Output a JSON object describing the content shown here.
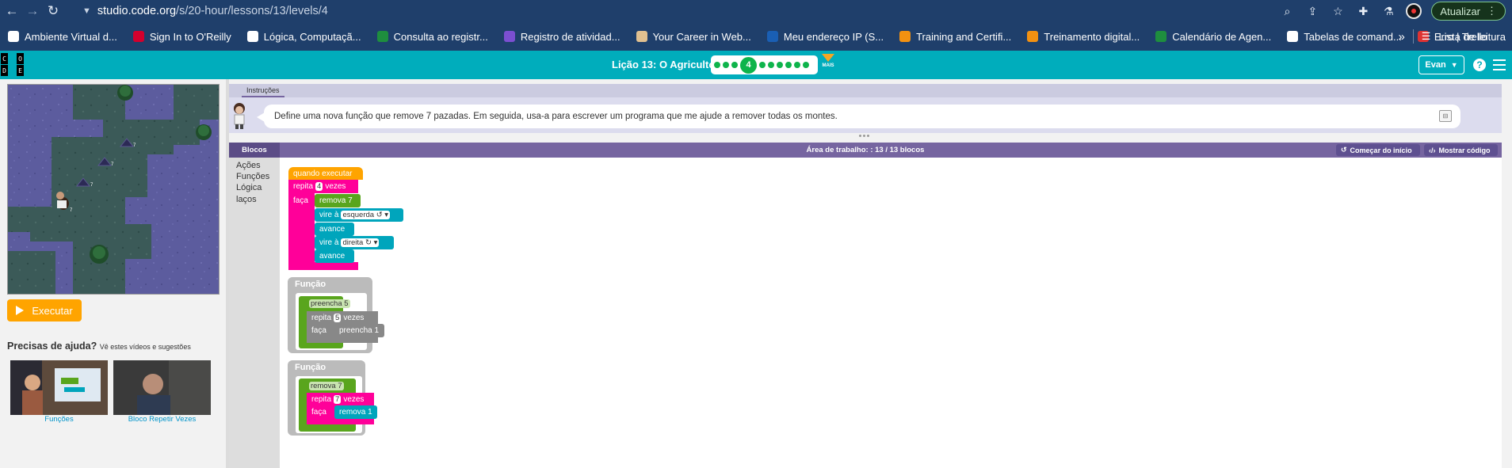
{
  "browser": {
    "url_host": "studio.code.org",
    "url_path": "/s/20-hour/lessons/13/levels/4",
    "update_label": "Atualizar"
  },
  "bookmarks": [
    {
      "label": "Ambiente Virtual d...",
      "color": "#ffffff"
    },
    {
      "label": "Sign In to O'Reilly",
      "color": "#d3002d"
    },
    {
      "label": "Lógica, Computaçã...",
      "color": "#ffffff"
    },
    {
      "label": "Consulta ao registr...",
      "color": "#1e8e3e"
    },
    {
      "label": "Registro de atividad...",
      "color": "#7b4fd1"
    },
    {
      "label": "Your Career in Web...",
      "color": "#e0c090"
    },
    {
      "label": "Meu endereço IP (S...",
      "color": "#1a5fb4"
    },
    {
      "label": "Training and Certifi...",
      "color": "#f29111"
    },
    {
      "label": "Treinamento digital...",
      "color": "#f29111"
    },
    {
      "label": "Calendário de Agen...",
      "color": "#1e8e3e"
    },
    {
      "label": "Tabelas de comand...",
      "color": "#ffffff"
    },
    {
      "label": "Erro | Trello",
      "color": "#d33"
    }
  ],
  "bookmarks_more": "»",
  "reading_list": "Lista de leitura",
  "header": {
    "logo_letters": [
      "C",
      "O",
      "D",
      "E"
    ],
    "lesson_title": "Lição 13: O Agricultor 2",
    "current_level": "4",
    "more_label": "MAIS",
    "user_name": "Evan",
    "help_glyph": "?"
  },
  "left": {
    "run_label": "Executar",
    "help_title": "Precisas de ajuda?",
    "help_sub": "Vê estes vídeos e sugestões",
    "videos": [
      {
        "label": "Funções"
      },
      {
        "label": "Bloco Repetir Vezes"
      }
    ]
  },
  "instructions": {
    "tab_label": "Instruções",
    "text": "Define uma nova função que remove 7 pazadas. Em seguida, usa-a para escrever um programa que me ajude a remover todas os montes."
  },
  "workspace": {
    "toolbox_tab": "Blocos",
    "title": "Área de trabalho: : 13 / 13 blocos",
    "reset_label": "Começar do início",
    "show_code_label": "Mostrar código",
    "categories": [
      "Ações",
      "Funções",
      "Lógica",
      "laços"
    ]
  },
  "blocks": {
    "when_run": "quando executar",
    "repeat": "repita",
    "times": "vezes",
    "do": "faça",
    "main_repeat_count": "4",
    "remove7_call": "remova 7",
    "turn": "vire à",
    "turn_left": "esquerda ↺ ▾",
    "forward": "avance",
    "turn_right": "direita ↻ ▾",
    "function_label": "Função",
    "fill5_name": "preencha 5",
    "fill5_repeat": "5",
    "fill1_call": "preencha 1",
    "remove7_name": "remova 7",
    "remove7_repeat": "7",
    "remove1_call": "remova 1"
  },
  "colors": {
    "accent": "#00adbc",
    "run": "#ffa400",
    "events": "#ffa400",
    "loops": "#ff0099",
    "functions": "#59a51d",
    "actions": "#00a5bc",
    "workspace_header": "#7665a0"
  }
}
